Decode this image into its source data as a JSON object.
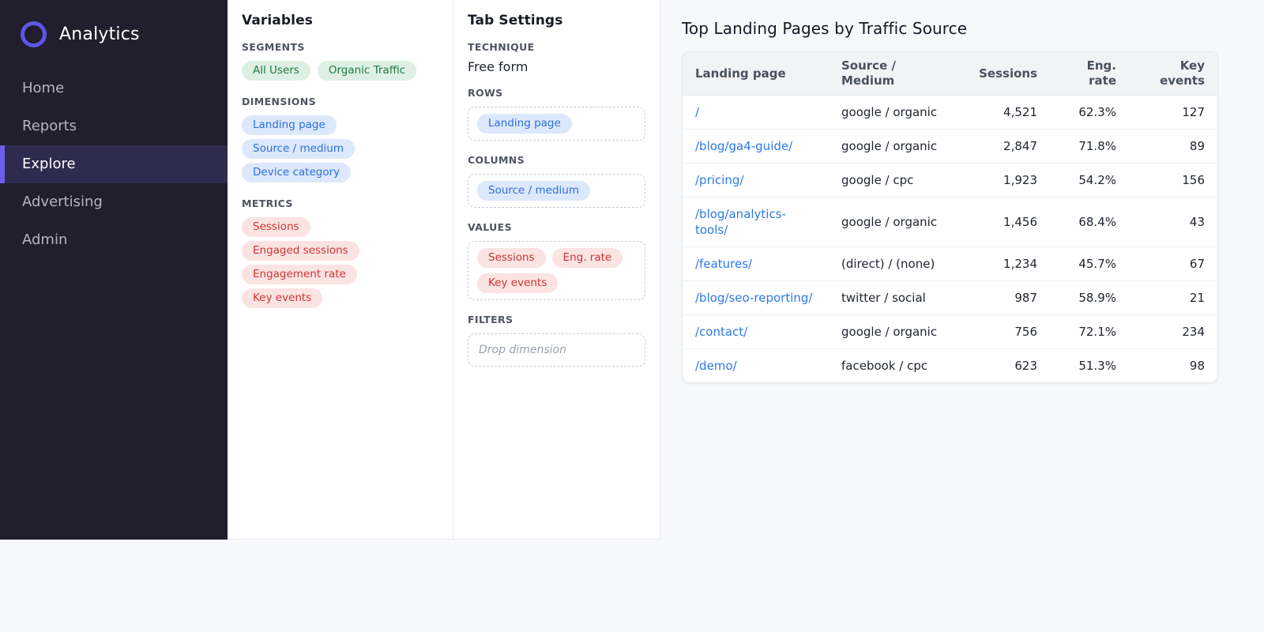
{
  "sidebar": {
    "logo_label": "Analytics",
    "items": [
      {
        "label": "Home",
        "active": false
      },
      {
        "label": "Reports",
        "active": false
      },
      {
        "label": "Explore",
        "active": true
      },
      {
        "label": "Advertising",
        "active": false
      },
      {
        "label": "Admin",
        "active": false
      }
    ]
  },
  "variables_panel": {
    "title": "Variables",
    "sections": [
      {
        "label": "SEGMENTS",
        "chip_style": "segment",
        "layout": "row",
        "chips": [
          "All Users",
          "Organic Traffic"
        ]
      },
      {
        "label": "DIMENSIONS",
        "chip_style": "dimension",
        "layout": "stack",
        "chips": [
          "Landing page",
          "Source / medium",
          "Device category"
        ]
      },
      {
        "label": "METRICS",
        "chip_style": "metric",
        "layout": "stack",
        "chips": [
          "Sessions",
          "Engaged sessions",
          "Engagement rate",
          "Key events"
        ]
      }
    ]
  },
  "tab_settings_panel": {
    "title": "Tab Settings",
    "technique_label": "TECHNIQUE",
    "technique_value": "Free form",
    "dropzones": [
      {
        "label": "ROWS",
        "chip_style": "dimension",
        "chips": [
          "Landing page"
        ]
      },
      {
        "label": "COLUMNS",
        "chip_style": "dimension",
        "chips": [
          "Source / medium"
        ]
      },
      {
        "label": "VALUES",
        "chip_style": "metric",
        "chips": [
          "Sessions",
          "Eng. rate",
          "Key events"
        ]
      },
      {
        "label": "FILTERS",
        "chip_style": "dimension",
        "chips": [],
        "placeholder": "Drop dimension"
      }
    ]
  },
  "main": {
    "title": "Top Landing Pages by Traffic Source",
    "table": {
      "columns": [
        {
          "label": "Landing page",
          "align": "left"
        },
        {
          "label": "Source /\nMedium",
          "align": "left"
        },
        {
          "label": "Sessions",
          "align": "right"
        },
        {
          "label": "Eng.\nrate",
          "align": "right"
        },
        {
          "label": "Key\nevents",
          "align": "right"
        }
      ],
      "rows": [
        {
          "landing_page": "/",
          "source_medium": "google / organic",
          "sessions": "4,521",
          "eng_rate": "62.3%",
          "key_events": "127"
        },
        {
          "landing_page": "/blog/ga4-guide/",
          "source_medium": "google / organic",
          "sessions": "2,847",
          "eng_rate": "71.8%",
          "key_events": "89"
        },
        {
          "landing_page": "/pricing/",
          "source_medium": "google / cpc",
          "sessions": "1,923",
          "eng_rate": "54.2%",
          "key_events": "156"
        },
        {
          "landing_page": "/blog/analytics-tools/",
          "source_medium": "google / organic",
          "sessions": "1,456",
          "eng_rate": "68.4%",
          "key_events": "43"
        },
        {
          "landing_page": "/features/",
          "source_medium": "(direct) / (none)",
          "sessions": "1,234",
          "eng_rate": "45.7%",
          "key_events": "67"
        },
        {
          "landing_page": "/blog/seo-reporting/",
          "source_medium": "twitter / social",
          "sessions": "987",
          "eng_rate": "58.9%",
          "key_events": "21"
        },
        {
          "landing_page": "/contact/",
          "source_medium": "google / organic",
          "sessions": "756",
          "eng_rate": "72.1%",
          "key_events": "234"
        },
        {
          "landing_page": "/demo/",
          "source_medium": "facebook / cpc",
          "sessions": "623",
          "eng_rate": "51.3%",
          "key_events": "98"
        }
      ]
    }
  },
  "colors": {
    "sidebar_bg": "#211e2d",
    "sidebar_active_bg": "#2f2b4e",
    "accent_purple": "#6e5fe6",
    "logo_ring": "#5c55e6",
    "segment_chip_bg": "#ddf0e3",
    "segment_chip_text": "#217a42",
    "dimension_chip_bg": "#dce8fb",
    "dimension_chip_text": "#2b6fe0",
    "metric_chip_bg": "#fbe3e2",
    "metric_chip_text": "#cc3531",
    "link_blue": "#2e79e6",
    "table_header_bg": "#f2f3f5",
    "main_bg": "#f7f8fa"
  }
}
